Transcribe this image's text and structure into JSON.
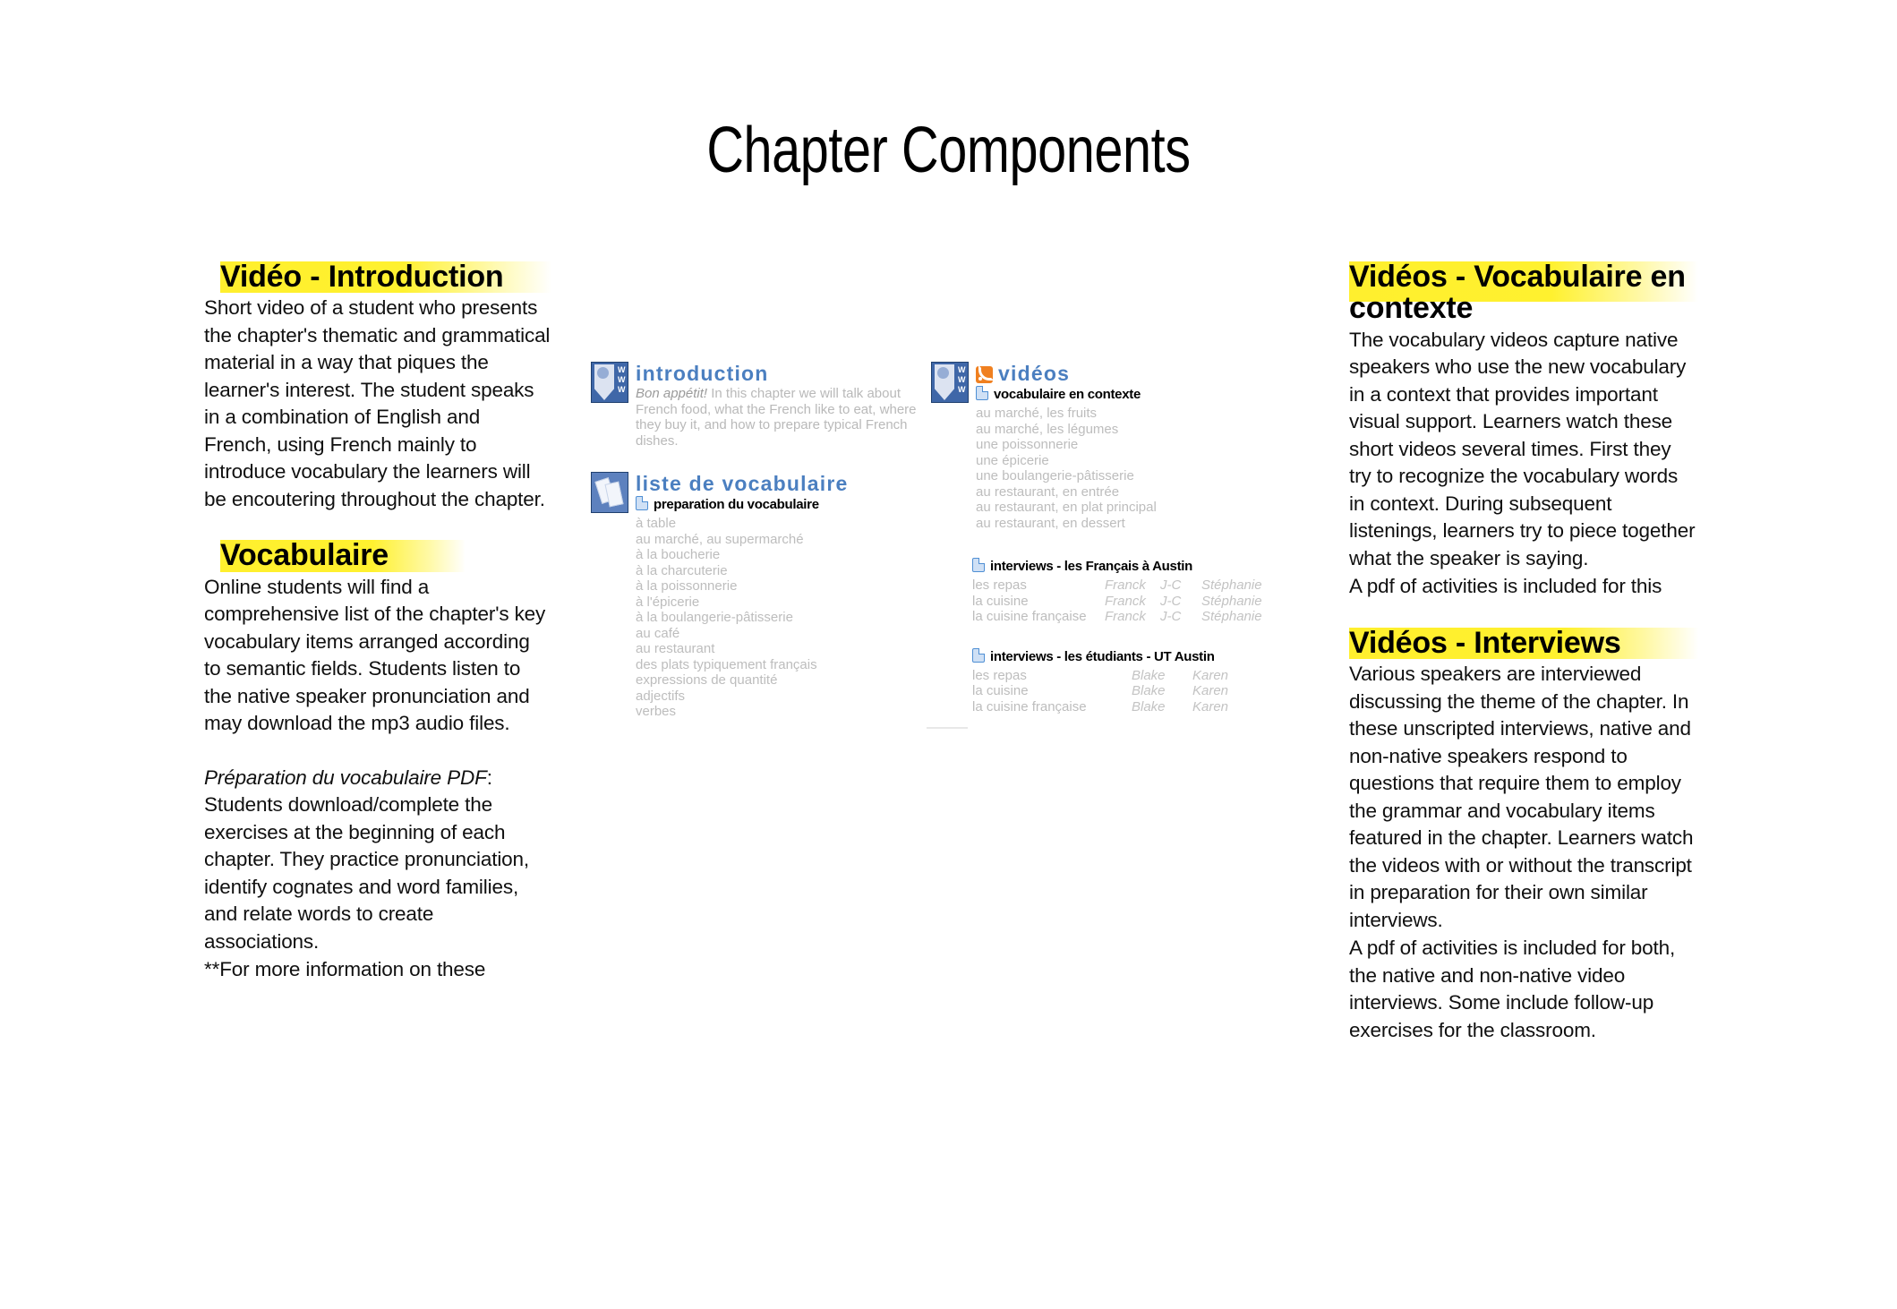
{
  "page": {
    "title": "Chapter Components"
  },
  "colors": {
    "highlight_yellow": "#FFEF2E",
    "screenshot_blue": "#4B7FC0",
    "rss_orange": "#F08020",
    "body_text": "#101010",
    "screenshot_gray": "#BDBDBD"
  },
  "left_column": {
    "sections": [
      {
        "heading": "Vidéo - Introduction",
        "paragraphs": [
          "Short video of a student who presents the chapter's thematic and grammatical material in a way that piques the learner's interest.  The student speaks in a combination of English and French, using French mainly to introduce vocabulary the learners will be encoutering throughout the chapter."
        ]
      },
      {
        "heading": "Vocabulaire",
        "paragraphs": [
          "Online students will find a comprehensive list of the chapter's key vocabulary items arranged according to semantic fields. Students listen to the native speaker pronunciation and may download the mp3 audio files."
        ],
        "pdf_note_italic": "Préparation du vocabulaire PDF",
        "pdf_note_rest": ": Students download/complete the exercises at the beginning of each chapter. They practice pronunciation, identify cognates and word families, and relate words to create associations.",
        "footnote": "**For more information on these"
      }
    ]
  },
  "right_column": {
    "sections": [
      {
        "heading": "Vidéos - Vocabulaire en contexte",
        "paragraphs": [
          "The vocabulary videos capture native speakers who use the new vocabulary in a context that provides important visual support. Learners watch these short videos several times. First they try to recognize the vocabulary words in context. During subsequent listenings, learners try to piece together what the speaker is saying.",
          "A pdf of activities is included for this"
        ]
      },
      {
        "heading": "Vidéos - Interviews",
        "paragraphs": [
          "Various speakers are interviewed discussing the theme of the chapter. In these unscripted interviews, native and non-native speakers respond to questions that require them to employ the grammar and vocabulary items featured in the chapter. Learners watch the videos with or without the transcript in preparation for their own similar interviews.",
          "A pdf of activities is included for both, the native and non-native video interviews. Some include follow-up exercises for the classroom."
        ]
      }
    ]
  },
  "screenshot": {
    "introduction": {
      "icon": "www-badge-icon",
      "title": "introduction",
      "lead_italic": "Bon appétit!",
      "description": " In this chapter we will talk about French food, what the French like to eat, where they buy it, and how to prepare typical French dishes."
    },
    "liste_de_vocabulaire": {
      "icon": "vocabulary-tag-icon",
      "title": "liste de vocabulaire",
      "subtitle": "preparation du vocabulaire",
      "items": [
        "à table",
        "au marché, au supermarché",
        "à la boucherie",
        "à la charcuterie",
        "à la poissonnerie",
        "à l'épicerie",
        "à la boulangerie-pâtisserie",
        "au café",
        "au restaurant",
        "des plats typiquement français",
        "expressions de quantité",
        "adjectifs",
        "verbes"
      ]
    },
    "videos": {
      "icon": "www-badge-icon",
      "rss_icon": "rss-icon",
      "title": "vidéos",
      "subtitle": "vocabulaire en contexte",
      "items": [
        "au marché, les fruits",
        "au marché, les légumes",
        "une poissonnerie",
        "une épicerie",
        "une boulangerie-pâtisserie",
        "au restaurant, en entrée",
        "au restaurant, en plat principal",
        "au restaurant, en dessert"
      ]
    },
    "interviews_francais": {
      "title": "interviews - les Français à Austin",
      "rows": [
        {
          "label": "les repas",
          "n1": "Franck",
          "n2": "J-C",
          "n3": "Stéphanie"
        },
        {
          "label": "la cuisine",
          "n1": "Franck",
          "n2": "J-C",
          "n3": "Stéphanie"
        },
        {
          "label": "la cuisine française",
          "n1": "Franck",
          "n2": "J-C",
          "n3": "Stéphanie"
        }
      ]
    },
    "interviews_etudiants": {
      "title": "interviews - les étudiants - UT Austin",
      "rows": [
        {
          "label": "les repas",
          "n1": "Blake",
          "n2": "Karen"
        },
        {
          "label": "la cuisine",
          "n1": "Blake",
          "n2": "Karen"
        },
        {
          "label": "la cuisine française",
          "n1": "Blake",
          "n2": "Karen"
        }
      ]
    }
  }
}
